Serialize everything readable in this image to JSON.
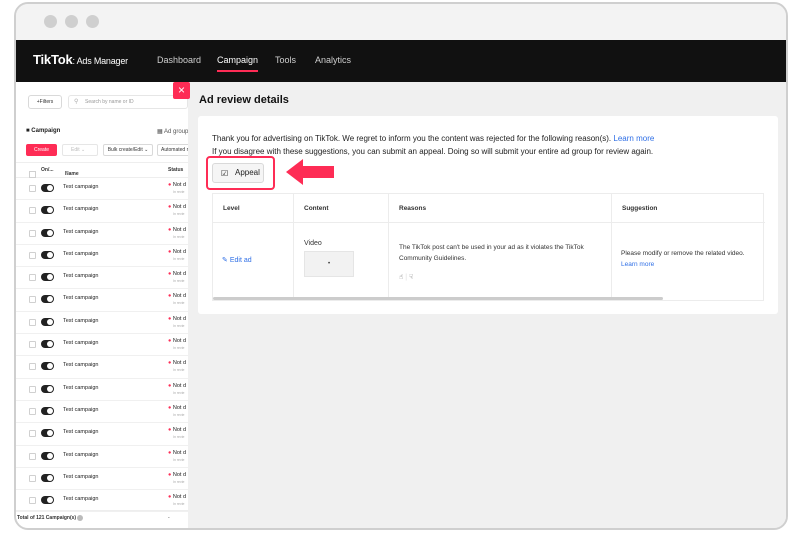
{
  "topnav": {
    "brand": "TikTok",
    "brand_sub": ": Ads Manager",
    "items": [
      "Dashboard",
      "Campaign",
      "Tools",
      "Analytics"
    ],
    "active": "Campaign"
  },
  "left": {
    "filters_label": "+Filters",
    "search_placeholder": "Search by name or ID",
    "tab_campaign": "Campaign",
    "tab_adgroup": "Ad group",
    "create_label": "Create",
    "edit_label": "Edit",
    "bulk_label": "Bulk create/Edit",
    "auto_label": "Automated rules",
    "col_onoff": "On/...",
    "col_name": "Name",
    "col_status": "Status",
    "row_name": "Test campaign",
    "row_status": "Not d",
    "row_sub": "In revie",
    "total": "Total of 121 Campaign(s)",
    "total_dash": "-"
  },
  "panel": {
    "close_icon": "×",
    "title": "Ad review details",
    "msg_line1": "Thank you for advertising on TikTok. We regret to inform you the content was rejected for the following reason(s).",
    "learn_more": "Learn more",
    "msg_line2": "If you disagree with these suggestions, you can submit an appeal. Doing so will submit your entire ad group for review again.",
    "appeal_label": "Appeal",
    "table": {
      "headers": [
        "Level",
        "Content",
        "Reasons",
        "Suggestion"
      ],
      "level_link": "Edit ad",
      "content_label": "Video",
      "content_thumb": "•",
      "reason": "The TikTok post can't be used in your ad as it violates the TikTok Community Guidelines.",
      "suggestion": "Please modify or remove the related video.",
      "suggestion_link": "Learn more"
    }
  },
  "colors": {
    "accent": "#fe2c55",
    "link": "#2f6fe6",
    "nav_bg": "#111111"
  }
}
